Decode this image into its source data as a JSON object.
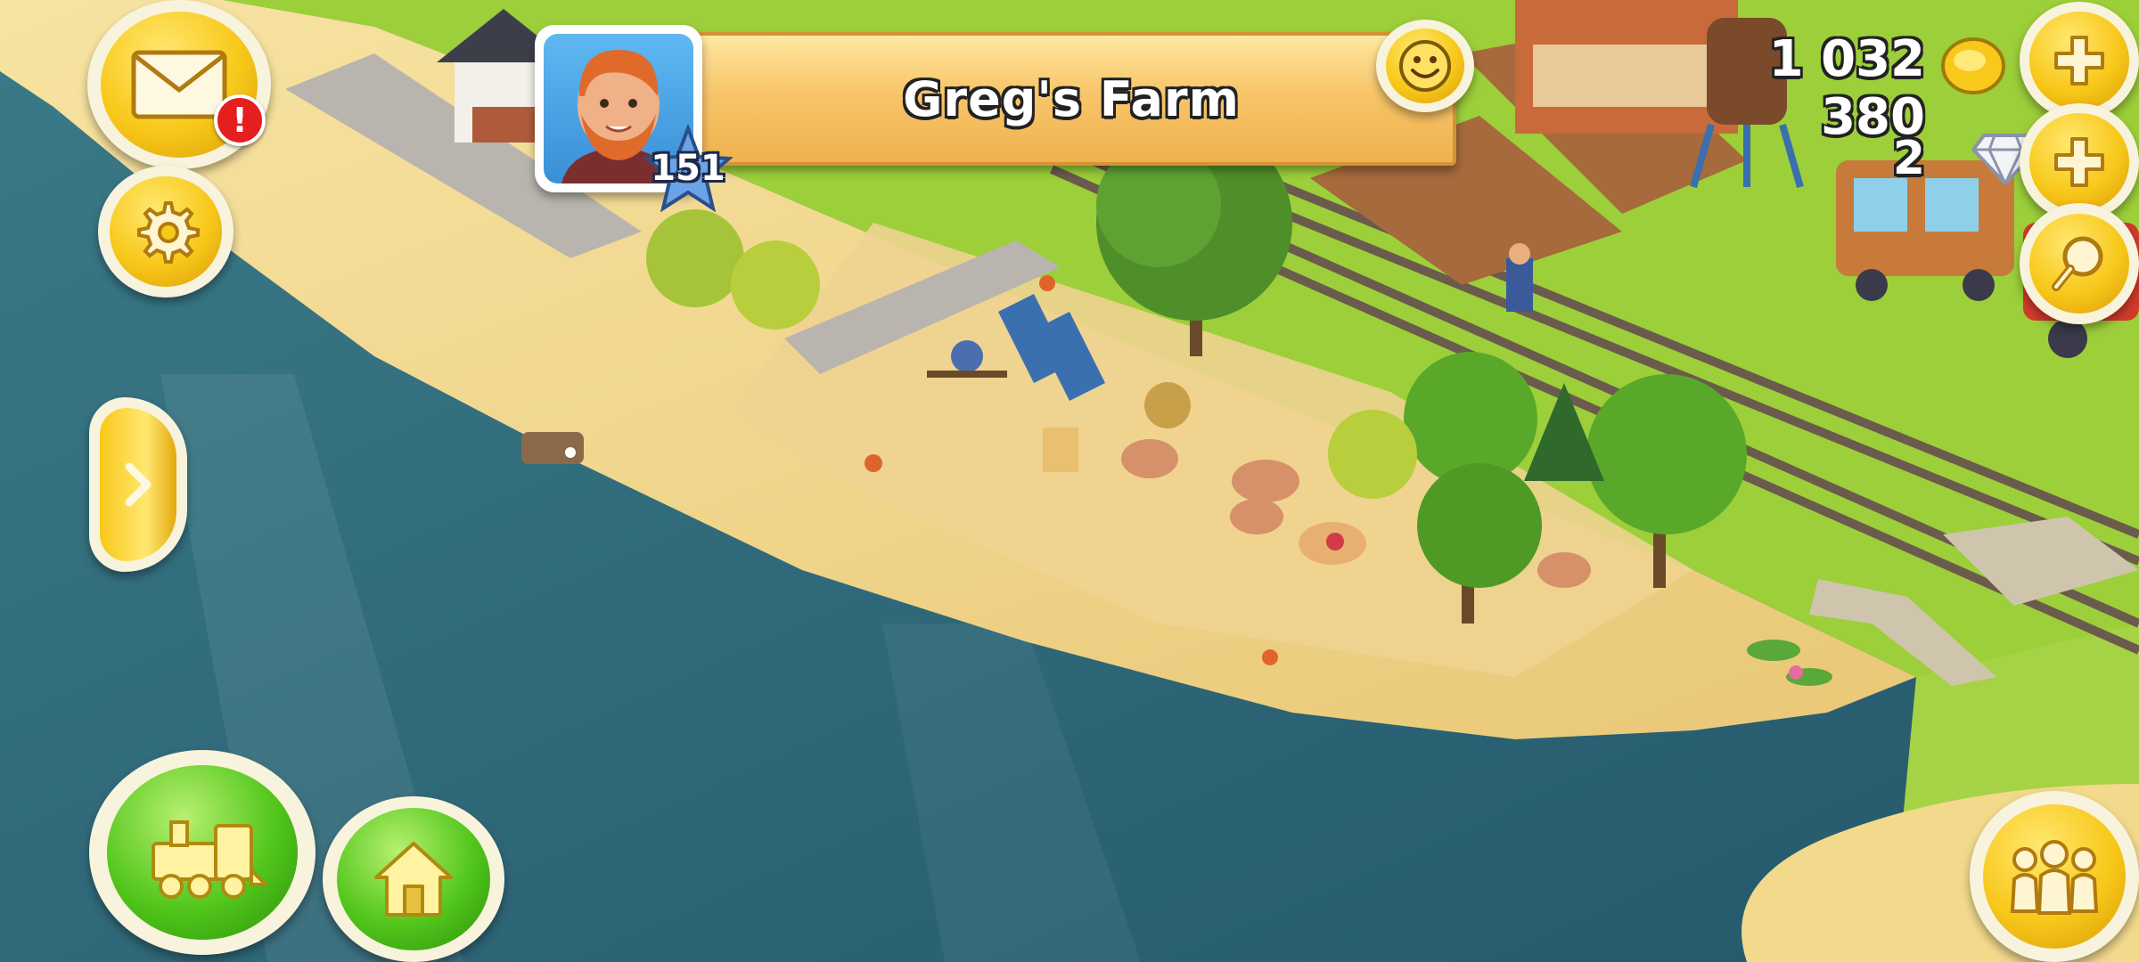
{
  "farm": {
    "name": "Greg's Farm",
    "level": "151"
  },
  "currency": {
    "coins": "1 032 380",
    "diamonds": "2"
  },
  "mail": {
    "notification": "!"
  },
  "icons": {
    "mail": "envelope-icon",
    "settings": "gear-icon",
    "expand": "chevron-right-icon",
    "train": "train-icon",
    "home": "house-icon",
    "friends": "people-icon",
    "search": "magnifier-icon",
    "add": "plus-icon",
    "emote": "smiley-icon",
    "coin": "coin-icon",
    "diamond": "diamond-icon"
  },
  "colors": {
    "gold": "#f8c81a",
    "green": "#52c61c",
    "cream": "#f8f3dc",
    "water": "#2e6675",
    "sand": "#f2d98c",
    "banner": "#f7c56a"
  }
}
